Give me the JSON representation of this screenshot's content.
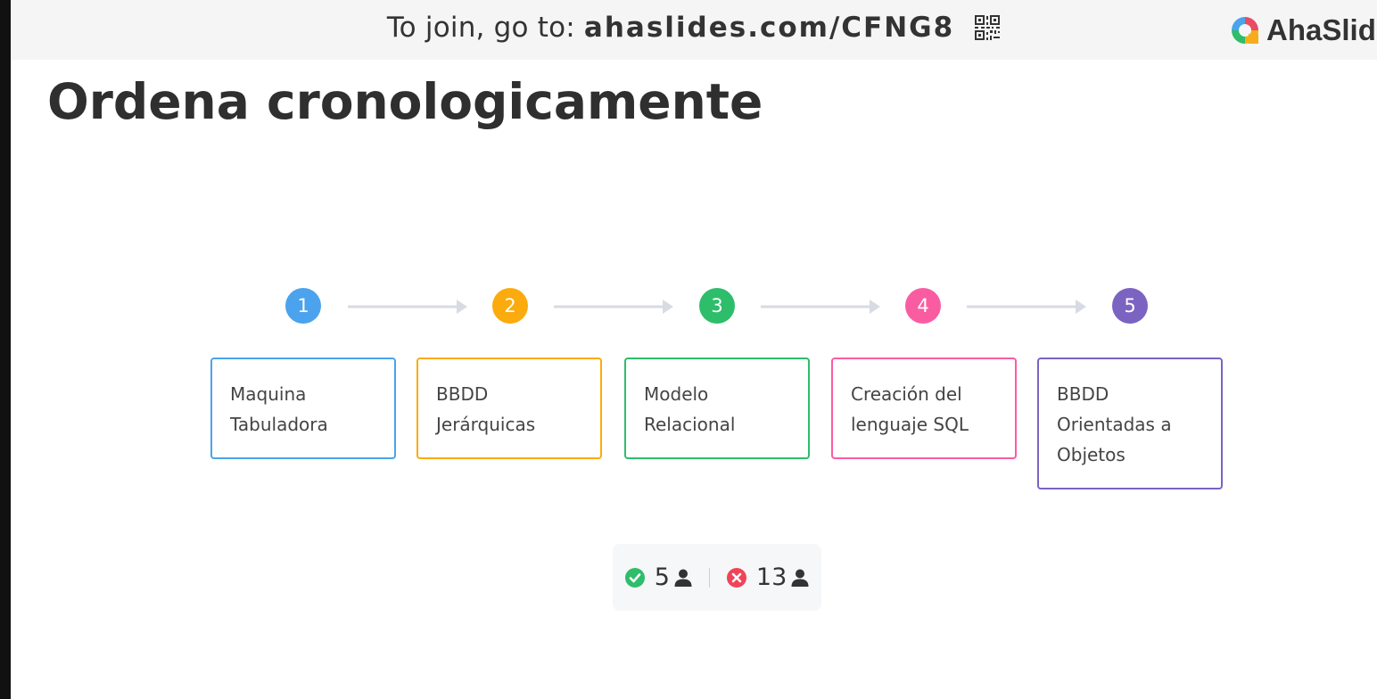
{
  "topbar": {
    "join_prefix": "To join, go to:",
    "join_code": "ahaslides.com/CFNG8",
    "qr_icon": "qr-code-icon",
    "brand_name": "AhaSlides",
    "brand_logo_icon": "ahaslides-logo-icon",
    "background_color": "#f5f5f5"
  },
  "slide": {
    "title": "Ordena cronologicamente",
    "steps": [
      {
        "number": "1",
        "label": "Maquina\nTabuladora",
        "color": "#4aa3ec"
      },
      {
        "number": "2",
        "label": "BBDD\nJerárquicas",
        "color": "#fbab0d"
      },
      {
        "number": "3",
        "label": "Modelo\nRelacional",
        "color": "#2ebd6b"
      },
      {
        "number": "4",
        "label": "Creación del\nlenguaje SQL",
        "color": "#fa5ca2"
      },
      {
        "number": "5",
        "label": "BBDD\nOrientadas a\nObjetos",
        "color": "#7b63c2"
      }
    ],
    "connector_color": "#d9dbe3"
  },
  "results": {
    "correct_count": "5",
    "correct_icon": "check-circle-icon",
    "correct_color": "#2ebd6b",
    "incorrect_count": "13",
    "incorrect_icon": "x-circle-icon",
    "incorrect_color": "#f04458",
    "user_icon": "user-icon"
  }
}
